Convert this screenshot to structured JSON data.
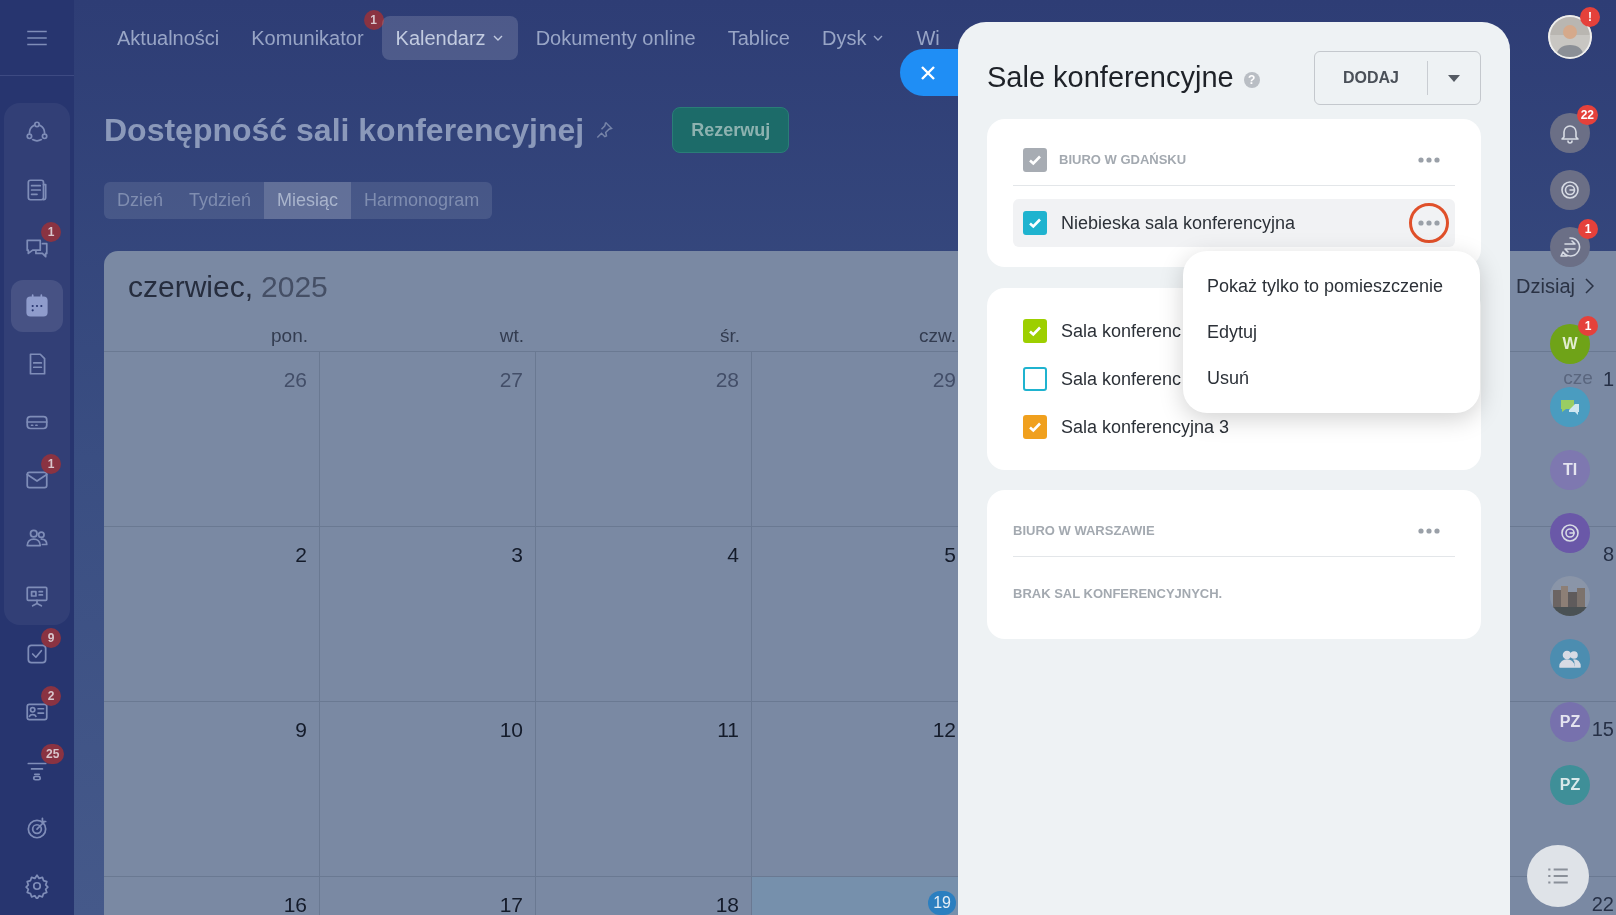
{
  "top_nav": {
    "items": [
      {
        "label": "Aktualności",
        "selected": false,
        "dropdown": false
      },
      {
        "label": "Komunikator",
        "selected": false,
        "dropdown": false,
        "badge": "1"
      },
      {
        "label": "Kalendarz",
        "selected": true,
        "dropdown": true
      },
      {
        "label": "Dokumenty online",
        "selected": false,
        "dropdown": false
      },
      {
        "label": "Tablice",
        "selected": false,
        "dropdown": false
      },
      {
        "label": "Dysk",
        "selected": false,
        "dropdown": true
      },
      {
        "label": "Wi",
        "selected": false,
        "dropdown": false
      }
    ]
  },
  "sidebar": {
    "pinned": [
      {
        "selected": false
      },
      {
        "selected": false
      },
      {
        "selected": false,
        "badge": "1"
      },
      {
        "selected": true
      },
      {
        "selected": false
      },
      {
        "selected": false
      },
      {
        "selected": false,
        "badge": "1"
      },
      {
        "selected": false
      },
      {
        "selected": false
      }
    ],
    "more": [
      {
        "selected": false,
        "badge": "9"
      },
      {
        "selected": false,
        "badge": "2"
      },
      {
        "selected": false,
        "badge": "25"
      },
      {
        "selected": false
      },
      {
        "selected": false
      }
    ]
  },
  "page": {
    "title": "Dostępność sali konferencyjnej",
    "reserve_button": "Rezerwuj",
    "view_tabs": [
      {
        "label": "Dzień",
        "selected": false
      },
      {
        "label": "Tydzień",
        "selected": false
      },
      {
        "label": "Miesiąc",
        "selected": true
      },
      {
        "label": "Harmonogram",
        "selected": false
      }
    ]
  },
  "calendar": {
    "month": "czerwiec,",
    "year": "2025",
    "today_button": "Dzisiaj",
    "weekdays": [
      "pon.",
      "wt.",
      "śr.",
      "czw."
    ],
    "weeks": [
      {
        "days": [
          {
            "day": "26",
            "muted": true,
            "today": false
          },
          {
            "day": "27",
            "muted": true,
            "today": false
          },
          {
            "day": "28",
            "muted": true,
            "today": false
          },
          {
            "day": "29",
            "muted": true,
            "today": false
          }
        ],
        "last": {
          "month": "cze",
          "day": "1"
        }
      },
      {
        "days": [
          {
            "day": "2",
            "muted": false,
            "today": false
          },
          {
            "day": "3",
            "muted": false,
            "today": false
          },
          {
            "day": "4",
            "muted": false,
            "today": false
          },
          {
            "day": "5",
            "muted": false,
            "today": false
          }
        ],
        "last": {
          "day": "8"
        }
      },
      {
        "days": [
          {
            "day": "9",
            "muted": false,
            "today": false
          },
          {
            "day": "10",
            "muted": false,
            "today": false
          },
          {
            "day": "11",
            "muted": false,
            "today": false
          },
          {
            "day": "12",
            "muted": false,
            "today": false
          }
        ],
        "last": {
          "day": "15"
        }
      },
      {
        "days": [
          {
            "day": "16",
            "muted": false,
            "today": false
          },
          {
            "day": "17",
            "muted": false,
            "today": false
          },
          {
            "day": "18",
            "muted": false,
            "today": false
          },
          {
            "day": "19",
            "muted": false,
            "today": true
          }
        ],
        "last": {
          "day": "22"
        }
      }
    ]
  },
  "panel": {
    "title": "Sale konferencyjne",
    "help_icon": "?",
    "add_button": "DODAJ",
    "sections": [
      {
        "title": "BIURO W GDAŃSKU",
        "checked": true,
        "rooms": [
          {
            "name": "Niebieska sala konferencyjna",
            "checked": true,
            "color": "#1fb3cf",
            "menu_open": true
          }
        ]
      },
      {
        "rooms": [
          {
            "name": "Sala konferenc",
            "checked": true,
            "color": "#9dcf00",
            "menu_open": false
          },
          {
            "name": "Sala konferenc",
            "checked": false,
            "color": "#1fb3cf",
            "menu_open": false
          },
          {
            "name": "Sala konferencyjna 3",
            "checked": true,
            "color": "#f0a01e",
            "menu_open": false
          }
        ]
      },
      {
        "title": "BIURO W WARSZAWIE",
        "empty_text": "BRAK SAL KONFERENCYJNYCH."
      }
    ],
    "context_menu": {
      "items": [
        "Pokaż tylko to pomieszczenie",
        "Edytuj",
        "Usuń"
      ]
    }
  },
  "rail": {
    "top": [
      {
        "badge": "!"
      },
      {
        "kind": "icon",
        "badge": "22"
      },
      {
        "kind": "icon"
      },
      {
        "kind": "icon",
        "badge": "1"
      }
    ],
    "contacts": [
      {
        "kind": "initials",
        "text": "W",
        "color": "#6fa318",
        "badge": "1"
      },
      {
        "kind": "icon",
        "color": "#4a9cc0"
      },
      {
        "kind": "initials",
        "text": "TI",
        "color": "#7e78b0"
      },
      {
        "kind": "icon",
        "color": "#6a58a8"
      },
      {
        "kind": "picture"
      },
      {
        "kind": "icon",
        "color": "#4c8db0"
      },
      {
        "kind": "initials",
        "text": "PZ",
        "color": "#7771ad"
      },
      {
        "kind": "initials",
        "text": "PZ",
        "color": "#3f8f98"
      }
    ]
  }
}
